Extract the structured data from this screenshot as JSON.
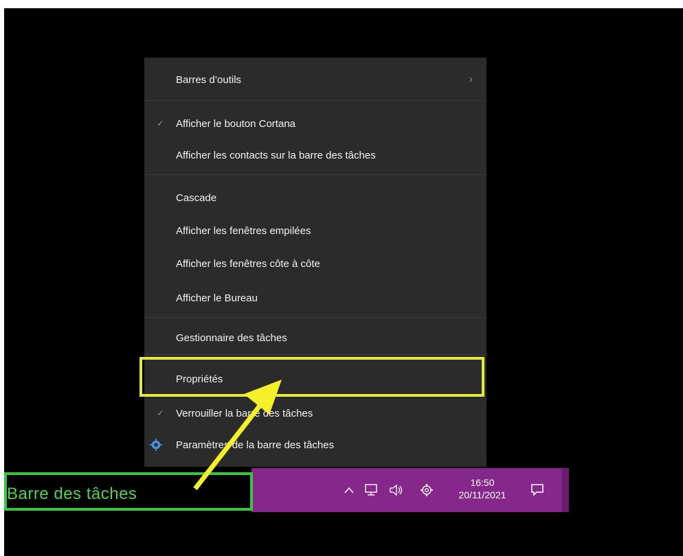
{
  "menu": {
    "items": [
      {
        "label": "Barres d’outils",
        "has_submenu": true
      },
      {
        "label": "Afficher le bouton Cortana",
        "checked": true
      },
      {
        "label": "Afficher les contacts sur la barre des tâches"
      },
      {
        "label": "Cascade"
      },
      {
        "label": "Afficher les fenêtres empilées"
      },
      {
        "label": "Afficher les fenêtres côte à côte"
      },
      {
        "label": "Afficher le Bureau"
      },
      {
        "label": "Gestionnaire des tâches"
      },
      {
        "label": "Propriétés"
      },
      {
        "label": "Verrouiller la barre des tâches",
        "checked": true
      },
      {
        "label": "Paramètres de la barre des tâches"
      }
    ],
    "check_glyph": "✓",
    "submenu_glyph": "›"
  },
  "taskbar": {
    "annotation_label": "Barre des tâches",
    "time": "16:50",
    "date": "20/11/2021",
    "color": "#86288b"
  },
  "annotation_colors": {
    "highlight": "#e3ea3c",
    "taskbar_box": "#38c63c",
    "arrow": "#f4f02a"
  }
}
